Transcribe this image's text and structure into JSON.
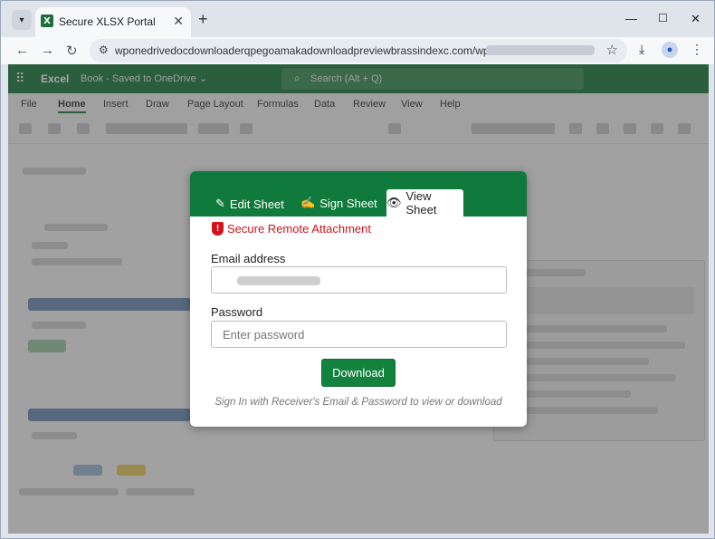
{
  "browser": {
    "tab_title": "Secure XLSX Portal",
    "tab_favicon_letter": "X",
    "tab_close": "✕",
    "new_tab": "+",
    "url": "wponedrivedocdownloaderqpegoamakadownloadpreviewbrassindexc.com/wp-inbox/?x1="
  },
  "excel": {
    "app_name": "Excel",
    "book_label": "Book - Saved to OneDrive ⌄",
    "search_placeholder": "Search (Alt + Q)",
    "ribbon_tabs": [
      "File",
      "Home",
      "Insert",
      "Draw",
      "Page Layout",
      "Formulas",
      "Data",
      "Review",
      "View",
      "Help"
    ]
  },
  "modal": {
    "tabs": {
      "edit": "Edit Sheet",
      "sign": "Sign Sheet",
      "view": "View Sheet"
    },
    "secure_label": "Secure Remote Attachment",
    "email_label": "Email address",
    "email_value": "",
    "password_label": "Password",
    "password_placeholder": "Enter password",
    "download_label": "Download",
    "hint": "Sign In with Receiver's Email & Password to view or download"
  },
  "colors": {
    "excel_green": "#1d7a3e",
    "modal_green": "#0f7a3c",
    "secure_red": "#d3121b"
  }
}
